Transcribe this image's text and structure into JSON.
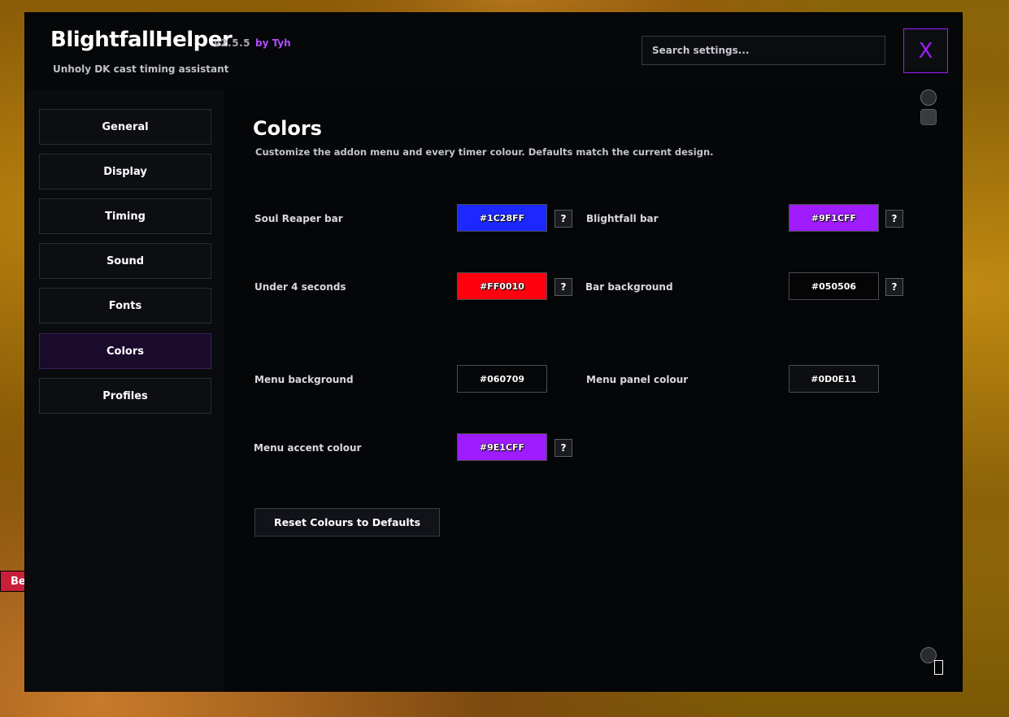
{
  "background_tag": "Be",
  "header": {
    "title": "BlightfallHelper",
    "version": "v2.5.5",
    "author": "by Tyh",
    "subtitle": "Unholy DK cast timing assistant",
    "search_placeholder": "Search settings...",
    "close_label": "X"
  },
  "sidebar": {
    "items": [
      {
        "label": "General"
      },
      {
        "label": "Display"
      },
      {
        "label": "Timing"
      },
      {
        "label": "Sound"
      },
      {
        "label": "Fonts"
      },
      {
        "label": "Colors",
        "active": true
      },
      {
        "label": "Profiles"
      }
    ]
  },
  "content": {
    "title": "Colors",
    "description": "Customize the addon menu and every timer colour. Defaults match the current design.",
    "colors": {
      "soul_reaper": {
        "label": "Soul Reaper bar",
        "value": "#1C28FF",
        "help": "?"
      },
      "blightfall": {
        "label": "Blightfall bar",
        "value": "#9F1CFF",
        "help": "?"
      },
      "under4": {
        "label": "Under 4 seconds",
        "value": "#FF0010",
        "help": "?"
      },
      "bar_bg": {
        "label": "Bar background",
        "value": "#050506",
        "help": "?"
      },
      "menu_bg": {
        "label": "Menu background",
        "value": "#060709"
      },
      "menu_panel": {
        "label": "Menu panel colour",
        "value": "#0D0E11"
      },
      "menu_accent": {
        "label": "Menu accent colour",
        "value": "#9E1CFF",
        "help": "?"
      }
    },
    "reset_label": "Reset Colours to Defaults"
  },
  "theme": {
    "accent": "#9F1CFF",
    "author_color": "#B04CFF"
  }
}
